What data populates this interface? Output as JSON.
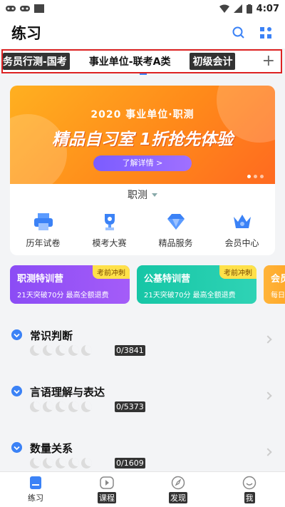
{
  "status_bar": {
    "time": "4:07"
  },
  "header": {
    "title": "练习",
    "icons": [
      "search-icon",
      "grid-icon"
    ]
  },
  "categories": {
    "tabs": [
      "务员行测-国考",
      "事业单位-联考A类",
      "初级会计"
    ],
    "add_label": "+"
  },
  "banner": {
    "subtitle": "2020 事业单位·职测",
    "title": "精品自习室 1折抢先体验",
    "button": "了解详情 >"
  },
  "selector": {
    "label": "职测"
  },
  "features": [
    {
      "label": "历年试卷",
      "icon": "printer-icon"
    },
    {
      "label": "模考大赛",
      "icon": "trophy-icon"
    },
    {
      "label": "精品服务",
      "icon": "diamond-icon"
    },
    {
      "label": "会员中心",
      "icon": "crown-icon"
    }
  ],
  "promos": [
    {
      "title": "职测特训营",
      "desc": "21天突破70分 最高全额退费",
      "tag": "考前冲刺"
    },
    {
      "title": "公基特训营",
      "desc": "21天突破70分 最高全额退费",
      "tag": "考前冲刺"
    },
    {
      "title": "会员",
      "desc": "每日"
    }
  ],
  "sections": [
    {
      "title": "常识判断",
      "count": "0/3841"
    },
    {
      "title": "言语理解与表达",
      "count": "0/5373"
    },
    {
      "title": "数量关系",
      "count": "0/1609"
    }
  ],
  "bottom_nav": [
    {
      "label": "练习",
      "icon": "practice-icon"
    },
    {
      "label": "课程",
      "icon": "play-icon"
    },
    {
      "label": "发现",
      "icon": "compass-icon"
    },
    {
      "label": "我",
      "icon": "smile-icon"
    }
  ],
  "colors": {
    "accent": "#3b82f6",
    "banner": "#ff8a1a",
    "highlight_border": "#dd2222"
  }
}
